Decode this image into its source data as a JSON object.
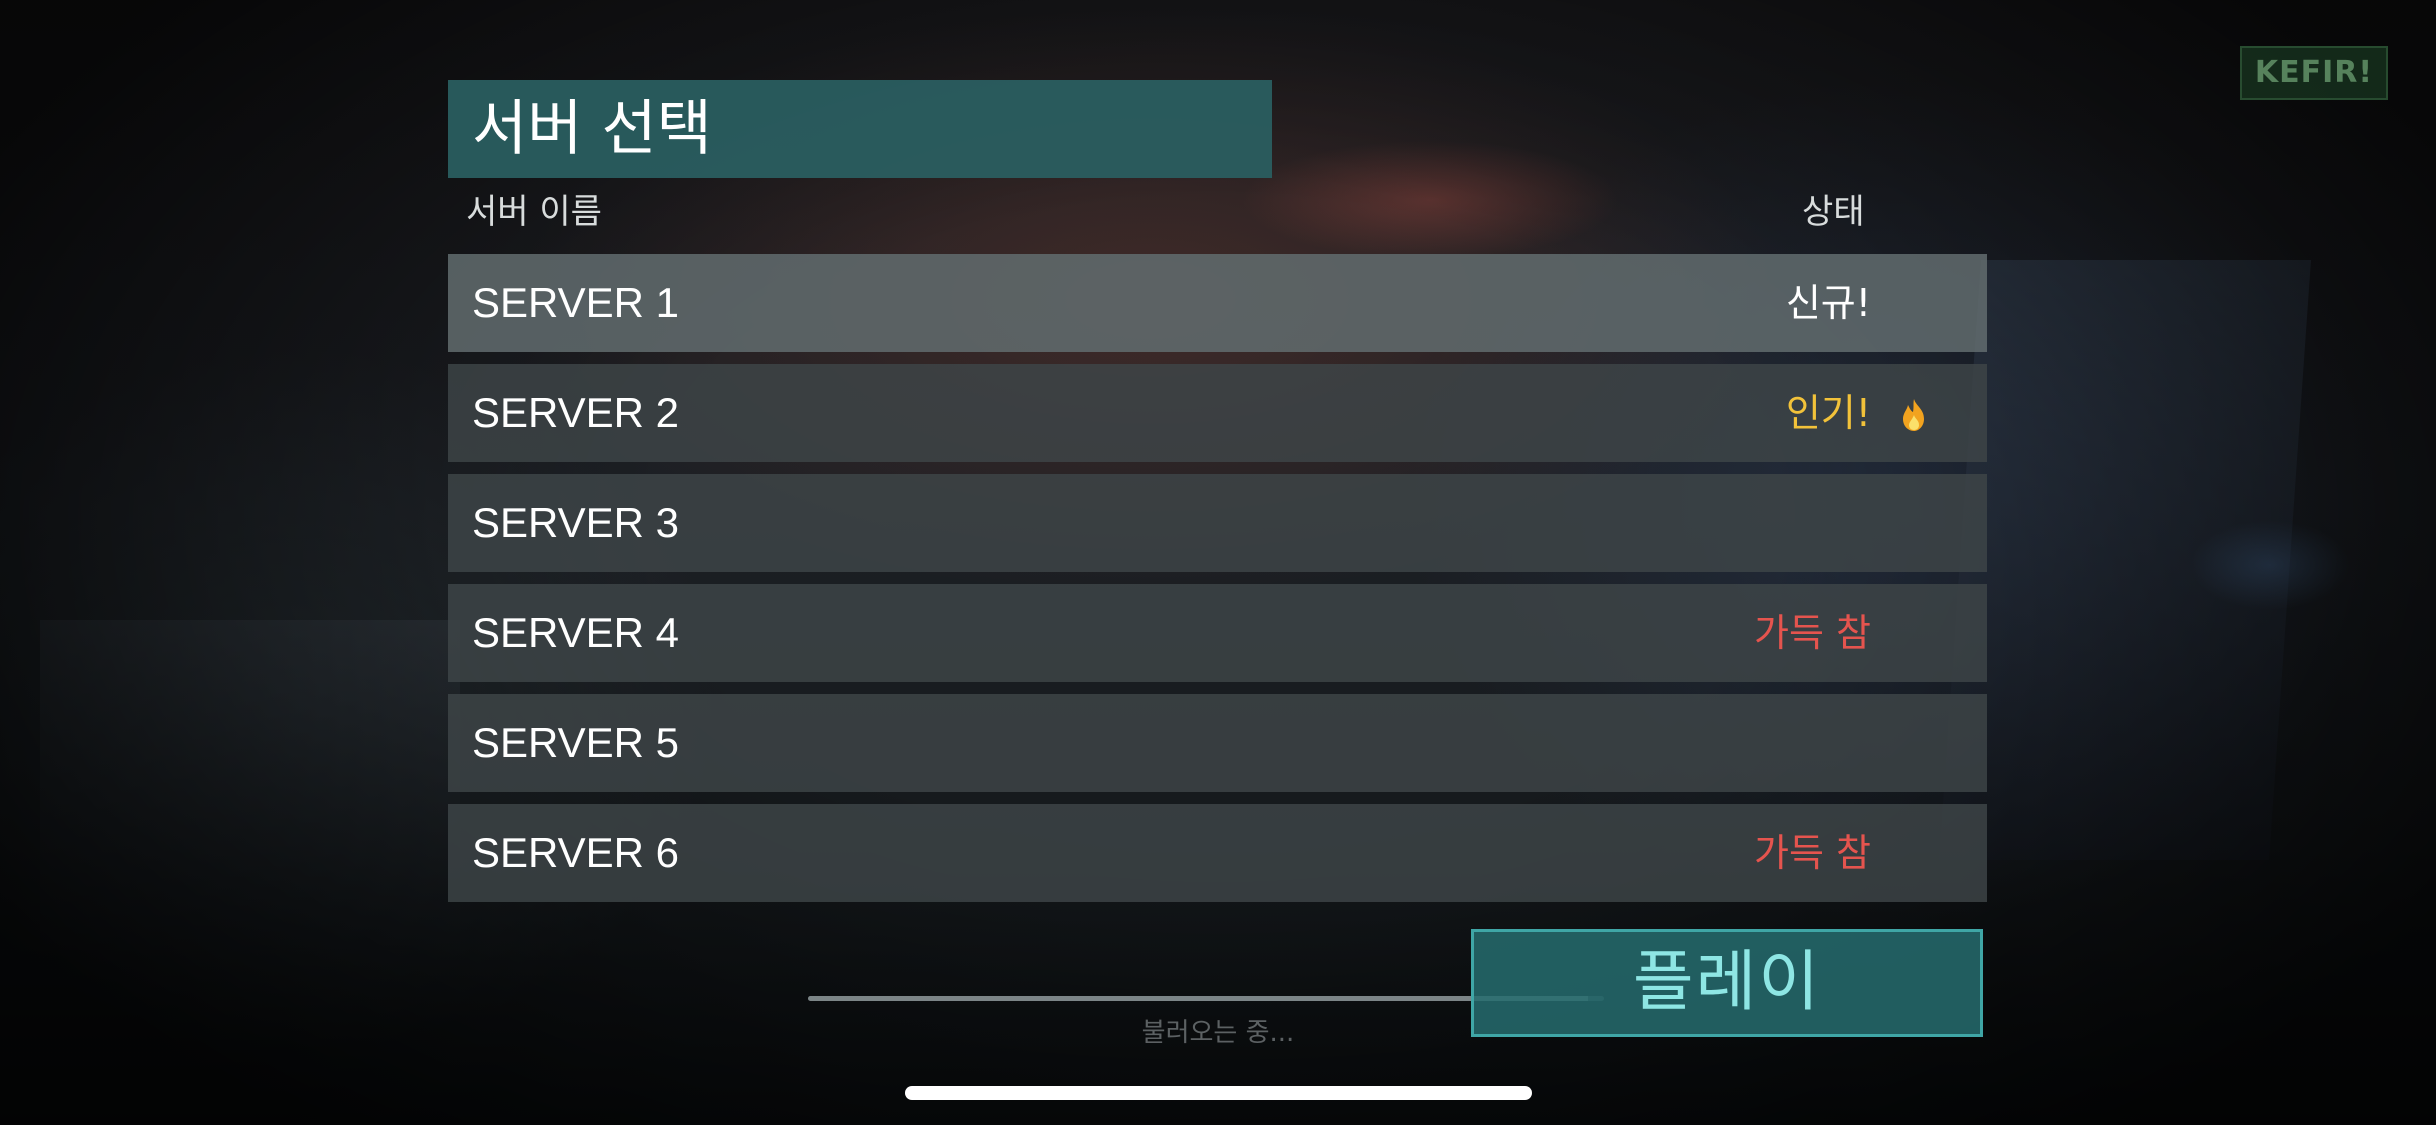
{
  "brand": {
    "logo_text": "KEFIR!"
  },
  "server_select": {
    "title": "서버 선택",
    "columns": {
      "name": "서버 이름",
      "status": "상태"
    },
    "servers": [
      {
        "name": "SERVER 1",
        "status": "신규!",
        "status_kind": "new",
        "selected": true
      },
      {
        "name": "SERVER 2",
        "status": "인기!",
        "status_kind": "hot",
        "icon": "fire-icon"
      },
      {
        "name": "SERVER 3",
        "status": ""
      },
      {
        "name": "SERVER 4",
        "status": "가득 참",
        "status_kind": "full"
      },
      {
        "name": "SERVER 5",
        "status": ""
      },
      {
        "name": "SERVER 6",
        "status": "가득 참",
        "status_kind": "full"
      }
    ]
  },
  "loading": {
    "text": "불러오는 중...",
    "progress": 0.98
  },
  "play_button": {
    "label": "플레이"
  },
  "colors": {
    "accent_teal": "#2a6062",
    "play_text": "#8ee6e4",
    "status_hot": "#f2c23a",
    "status_full": "#e5544e"
  }
}
